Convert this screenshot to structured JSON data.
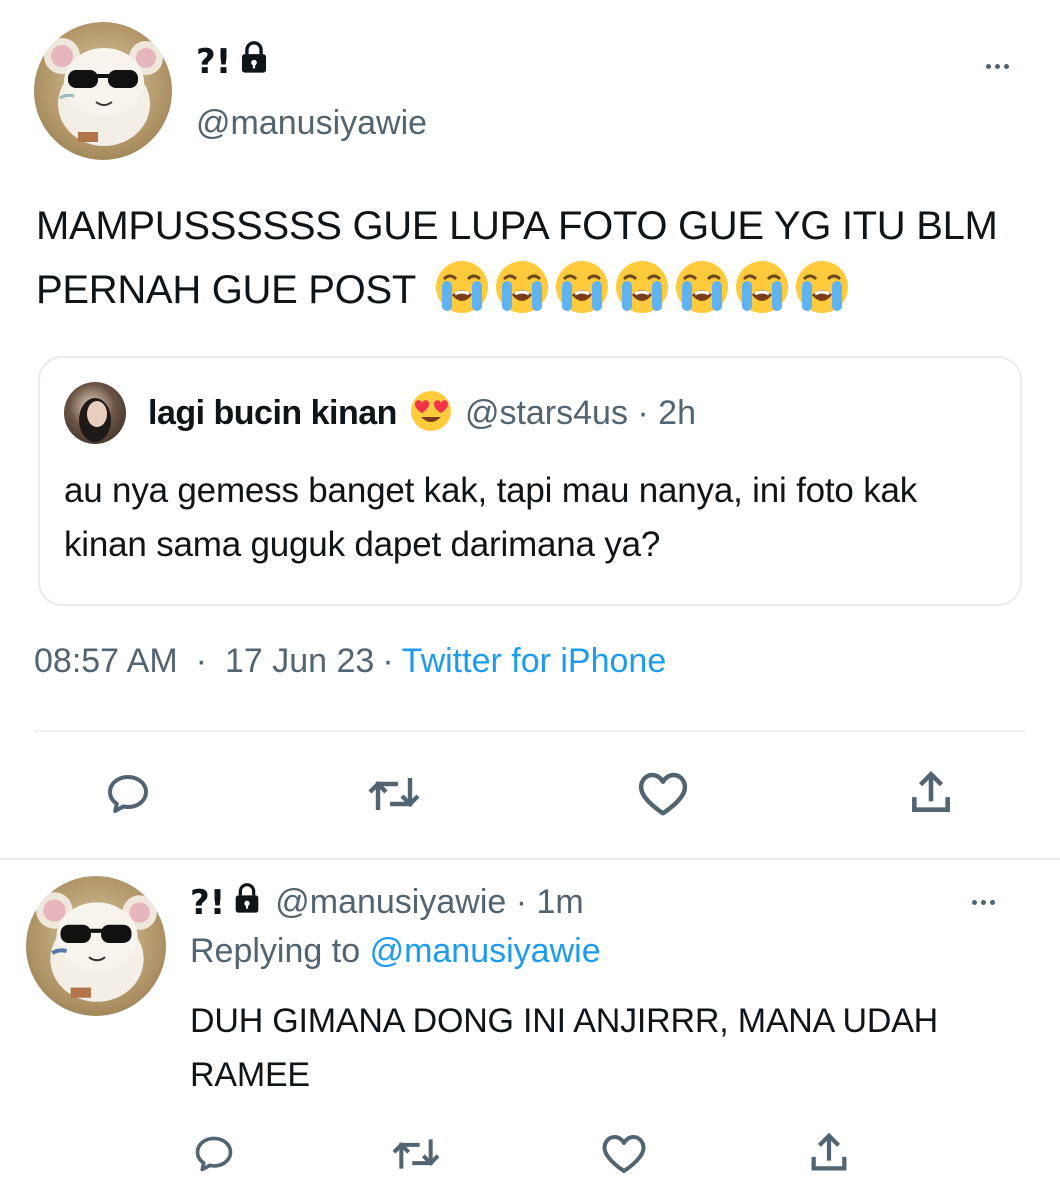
{
  "main_tweet": {
    "display_name": "?!",
    "handle": "@manusiyawie",
    "text": "MAMPUSSSSSS GUE LUPA FOTO GUE YG ITU BLM PERNAH GUE POST",
    "emoji_count": 7,
    "emoji_name": "loudly-crying-face",
    "time": "08:57 AM",
    "date": "17 Jun 23",
    "separator": "·",
    "source": "Twitter for iPhone",
    "quoted": {
      "display_name": "lagi bucin kinan",
      "handle": "@stars4us · 2h",
      "text": "au nya gemess banget kak, tapi mau nanya, ini foto kak kinan sama guguk dapet darimana ya?"
    }
  },
  "reply": {
    "display_name": "?!",
    "handle": "@manusiyawie · 1m",
    "replying_label": "Replying to",
    "replying_to": "@manusiyawie",
    "text": "DUH GIMANA DONG INI ANJIRRR, MANA UDAH RAMEE"
  },
  "colors": {
    "text": "#0f1419",
    "secondary": "#536471",
    "accent": "#1d9bf0",
    "border": "#e6ecf0"
  },
  "icons": [
    "lock-icon",
    "more-icon",
    "reply-icon",
    "retweet-icon",
    "like-icon",
    "share-icon"
  ]
}
